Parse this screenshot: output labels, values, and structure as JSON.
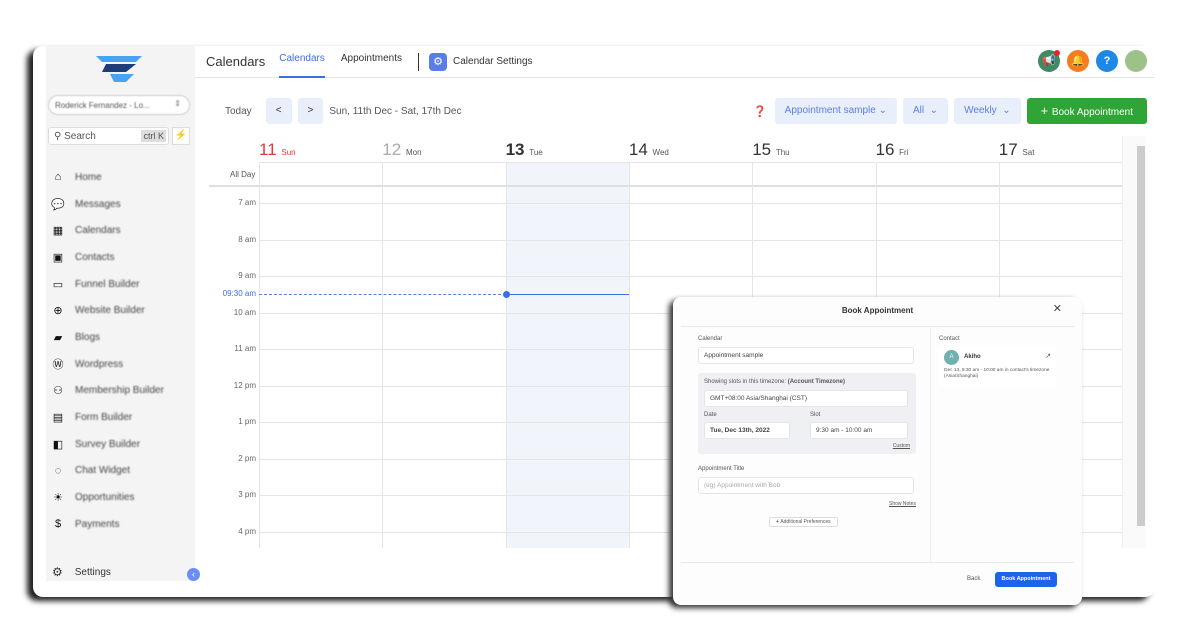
{
  "sidebar": {
    "account": "Roderick Fernandez - Lo...",
    "search_placeholder": "Search",
    "search_shortcut": "ctrl K",
    "items": [
      {
        "label": "Home",
        "icon": "home-icon",
        "glyph": "⌂"
      },
      {
        "label": "Messages",
        "icon": "chat-icon",
        "glyph": "💬"
      },
      {
        "label": "Calendars",
        "icon": "calendar-icon",
        "glyph": "▦"
      },
      {
        "label": "Contacts",
        "icon": "contacts-icon",
        "glyph": "▣"
      },
      {
        "label": "Funnel Builder",
        "icon": "funnel-icon",
        "glyph": "▭"
      },
      {
        "label": "Website Builder",
        "icon": "globe-icon",
        "glyph": "⊕"
      },
      {
        "label": "Blogs",
        "icon": "blog-icon",
        "glyph": "▰"
      },
      {
        "label": "Wordpress",
        "icon": "wordpress-icon",
        "glyph": "Ⓦ"
      },
      {
        "label": "Membership Builder",
        "icon": "members-icon",
        "glyph": "⚇"
      },
      {
        "label": "Form Builder",
        "icon": "form-icon",
        "glyph": "▤"
      },
      {
        "label": "Survey Builder",
        "icon": "survey-icon",
        "glyph": "◧"
      },
      {
        "label": "Chat Widget",
        "icon": "chat-widget-icon",
        "glyph": "◌"
      },
      {
        "label": "Opportunities",
        "icon": "bulb-icon",
        "glyph": "☀"
      },
      {
        "label": "Payments",
        "icon": "payments-icon",
        "glyph": "$"
      }
    ],
    "settings": "Settings"
  },
  "header": {
    "title": "Calendars",
    "tabs": [
      "Calendars",
      "Appointments"
    ],
    "settings_tab": "Calendar Settings"
  },
  "toolbar": {
    "today": "Today",
    "prev": "<",
    "next": ">",
    "range": "Sun, 11th Dec - Sat, 17th Dec",
    "calendar_filter": "Appointment sample",
    "user_filter": "All",
    "view": "Weekly",
    "book": "Book Appointment"
  },
  "calendar": {
    "days": [
      {
        "num": "11",
        "name": "Sun"
      },
      {
        "num": "12",
        "name": "Mon"
      },
      {
        "num": "13",
        "name": "Tue"
      },
      {
        "num": "14",
        "name": "Wed"
      },
      {
        "num": "15",
        "name": "Thu"
      },
      {
        "num": "16",
        "name": "Fri"
      },
      {
        "num": "17",
        "name": "Sat"
      }
    ],
    "all_day": "All Day",
    "hours": [
      "7 am",
      "8 am",
      "9 am",
      "10 am",
      "11 am",
      "12 pm",
      "1 pm",
      "2 pm",
      "3 pm",
      "4 pm"
    ],
    "current_time": "09:30 am",
    "colors": {
      "today_red": "#e53935",
      "accent": "#3b6fe0"
    }
  },
  "modal": {
    "title": "Book Appointment",
    "calendar_label": "Calendar",
    "calendar_value": "Appointment sample",
    "timezone_label": "Showing slots in this timezone:",
    "timezone_bold": "(Account Timezone)",
    "timezone_value": "GMT+08:00 Asia/Shanghai (CST)",
    "date_label": "Date",
    "date_value": "Tue, Dec 13th, 2022",
    "slot_label": "Slot",
    "slot_value": "9:30 am - 10:00 am",
    "custom": "Custom",
    "appt_title_label": "Appointment Title",
    "appt_title_placeholder": "(eg) Appointment with Bob",
    "show_notes": "Show Notes",
    "additional": "Additional Preferences",
    "contact_label": "Contact",
    "contact_initial": "A",
    "contact_name": "Akiho",
    "contact_detail": "Dec 13, 9:30 am - 10:00 am in contact's timezone (Asia/Shanghai)",
    "back": "Back",
    "book": "Book Appointment"
  }
}
